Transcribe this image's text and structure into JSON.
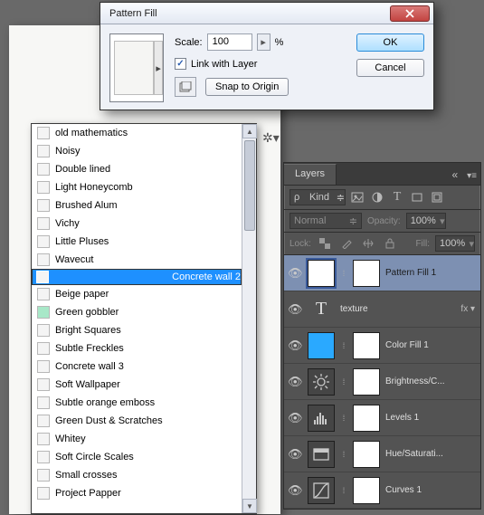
{
  "dialog": {
    "title": "Pattern Fill",
    "scale_label": "Scale:",
    "scale_value": "100",
    "scale_unit": "%",
    "link_label": "Link with Layer",
    "snap_label": "Snap to Origin",
    "ok": "OK",
    "cancel": "Cancel"
  },
  "patterns": [
    "old mathematics",
    "Noisy",
    "Double lined",
    "Light Honeycomb",
    "Brushed Alum",
    "Vichy",
    "Little Pluses",
    "Wavecut",
    "Concrete wall 2",
    "Beige paper",
    "Green gobbler",
    "Bright Squares",
    "Subtle Freckles",
    "Concrete wall 3",
    "Soft Wallpaper",
    "Subtle orange emboss",
    "Green Dust & Scratches",
    "Whitey",
    "Soft Circle Scales",
    "Small crosses",
    "Project Papper"
  ],
  "patterns_selected_index": 8,
  "swatch_colors": {
    "10": "#a8e8c8"
  },
  "panel": {
    "tab": "Layers",
    "kind": "Kind",
    "blend": "Normal",
    "opacity_label": "Opacity:",
    "opacity": "100%",
    "lock_label": "Lock:",
    "fill_label": "Fill:",
    "fill": "100%"
  },
  "layers": [
    {
      "name": "Pattern Fill 1",
      "type": "pattern",
      "selected": true
    },
    {
      "name": "texture",
      "type": "text",
      "fx": true
    },
    {
      "name": "Color Fill 1",
      "type": "color",
      "color": "#2aa9ff"
    },
    {
      "name": "Brightness/C...",
      "type": "brightness"
    },
    {
      "name": "Levels 1",
      "type": "levels"
    },
    {
      "name": "Hue/Saturati...",
      "type": "hue"
    },
    {
      "name": "Curves 1",
      "type": "curves"
    }
  ]
}
